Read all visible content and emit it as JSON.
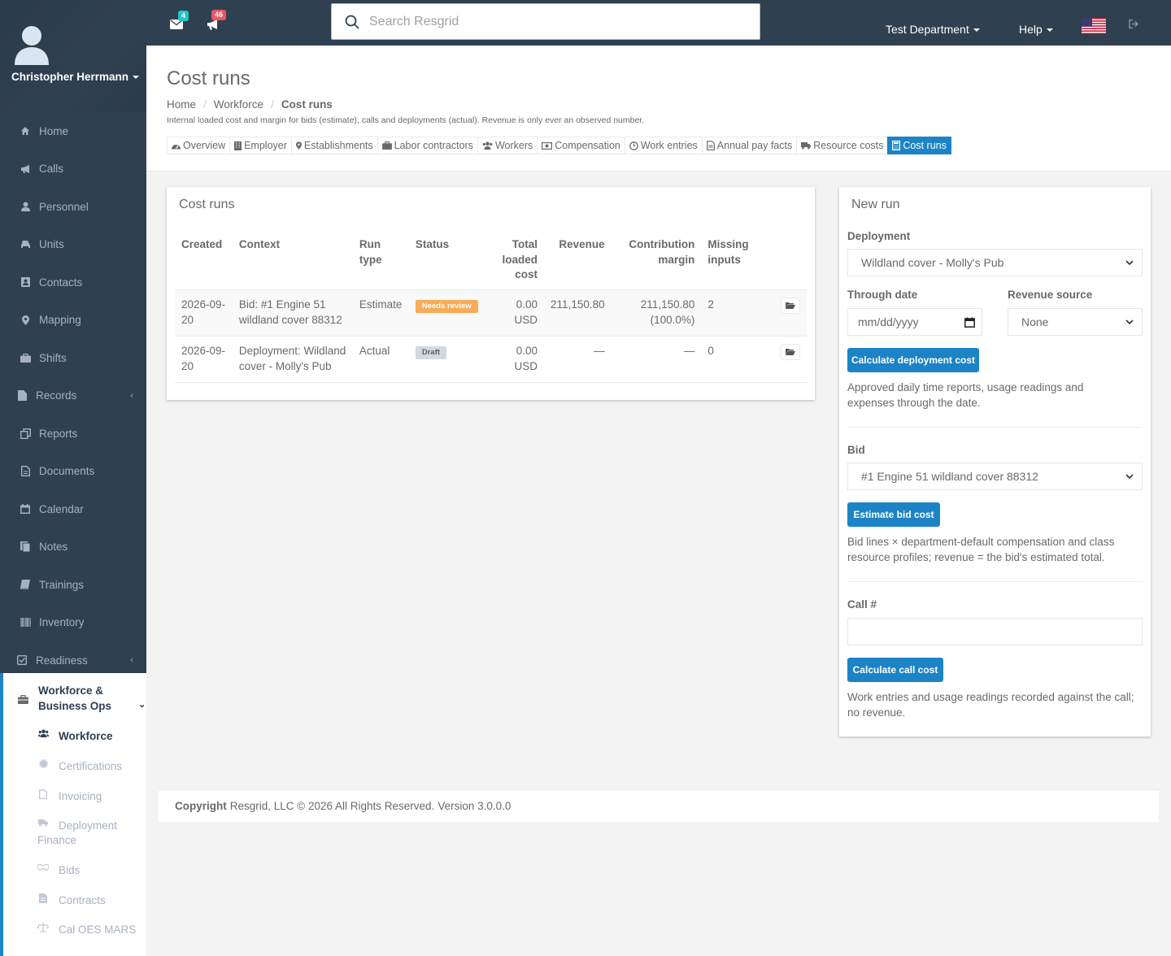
{
  "user": {
    "name": "Christopher Herrmann"
  },
  "topbar": {
    "mail_count": "4",
    "alert_count": "46",
    "search_placeholder": "Search Resgrid",
    "department": "Test Department",
    "help": "Help",
    "colors": {
      "bar": "#2f4050",
      "mail_badge": "#23c6c8",
      "alert_badge": "#ed5565"
    }
  },
  "sidebar": {
    "items": [
      {
        "label": "Home",
        "icon": "home-icon"
      },
      {
        "label": "Calls",
        "icon": "bullhorn-icon"
      },
      {
        "label": "Personnel",
        "icon": "user-icon"
      },
      {
        "label": "Units",
        "icon": "truck-icon"
      },
      {
        "label": "Contacts",
        "icon": "address-book-icon"
      },
      {
        "label": "Mapping",
        "icon": "map-marker-icon"
      },
      {
        "label": "Shifts",
        "icon": "briefcase-icon"
      },
      {
        "label": "Records",
        "icon": "file-icon"
      },
      {
        "label": "Reports",
        "icon": "copy-icon"
      },
      {
        "label": "Documents",
        "icon": "document-icon"
      },
      {
        "label": "Calendar",
        "icon": "calendar-icon"
      },
      {
        "label": "Notes",
        "icon": "notes-icon"
      },
      {
        "label": "Trainings",
        "icon": "book-icon"
      },
      {
        "label": "Inventory",
        "icon": "barcode-icon"
      },
      {
        "label": "Readiness",
        "icon": "check-square-icon"
      }
    ],
    "active_group": {
      "label_line1": "Workforce &",
      "label_line2": "Business Ops",
      "children": [
        {
          "label": "Workforce",
          "icon": "users-icon"
        },
        {
          "label": "Certifications",
          "icon": "certificate-icon"
        },
        {
          "label": "Invoicing",
          "icon": "invoice-icon"
        },
        {
          "label": "Deployment",
          "label2": "Finance",
          "icon": "truck-icon"
        },
        {
          "label": "Bids",
          "icon": "handshake-icon"
        },
        {
          "label": "Contracts",
          "icon": "contract-icon"
        },
        {
          "label": "Cal OES MARS",
          "icon": "balance-scale-icon"
        }
      ]
    }
  },
  "page": {
    "title": "Cost runs",
    "breadcrumb": [
      "Home",
      "Workforce",
      "Cost runs"
    ],
    "subtitle": "Internal loaded cost and margin for bids (estimate), calls and deployments (actual). Revenue is only ever an observed number.",
    "tabs": [
      {
        "label": "Overview",
        "icon": "dashboard-icon"
      },
      {
        "label": "Employer",
        "icon": "building-icon"
      },
      {
        "label": "Establishments",
        "icon": "map-marker-icon"
      },
      {
        "label": "Labor contractors",
        "icon": "briefcase-icon"
      },
      {
        "label": "Workers",
        "icon": "users-icon"
      },
      {
        "label": "Compensation",
        "icon": "money-icon"
      },
      {
        "label": "Work entries",
        "icon": "clock-icon"
      },
      {
        "label": "Annual pay facts",
        "icon": "file-text-icon"
      },
      {
        "label": "Resource costs",
        "icon": "truck-icon"
      },
      {
        "label": "Cost runs",
        "icon": "calculator-icon"
      }
    ]
  },
  "runs": {
    "title": "Cost runs",
    "headers": {
      "created": "Created",
      "context": "Context",
      "run_type_1": "Run",
      "run_type_2": "type",
      "status": "Status",
      "total_1": "Total",
      "total_2": "loaded",
      "total_3": "cost",
      "revenue": "Revenue",
      "margin_1": "Contribution",
      "margin_2": "margin",
      "missing_1": "Missing",
      "missing_2": "inputs"
    },
    "rows": [
      {
        "created_1": "2026-09-",
        "created_2": "20",
        "context_1": "Bid: #1 Engine 51",
        "context_2": "wildland cover 88312",
        "run_type": "Estimate",
        "status": "Needs review",
        "total": "0.00 USD",
        "revenue": "211,150.80",
        "margin_1": "211,150.80",
        "margin_2": "(100.0%)",
        "missing": "2"
      },
      {
        "created_1": "2026-09-",
        "created_2": "20",
        "context_1": "Deployment: Wildland",
        "context_2": "cover - Molly's Pub",
        "run_type": "Actual",
        "status": "Draft",
        "total": "0.00 USD",
        "revenue": "—",
        "margin_1": "—",
        "margin_2": "",
        "missing": "0"
      }
    ]
  },
  "new_run": {
    "title": "New run",
    "deployment_label": "Deployment",
    "deployment_value": "Wildland cover - Molly's Pub",
    "through_date_label": "Through date",
    "through_date_placeholder": "mm/dd/yyyy",
    "revenue_source_label": "Revenue source",
    "revenue_source_value": "None",
    "calc_deployment_button": "Calculate deployment cost",
    "deployment_help": "Approved daily time reports, usage readings and expenses through the date.",
    "bid_label": "Bid",
    "bid_value": "#1 Engine 51 wildland cover 88312",
    "estimate_bid_button": "Estimate bid cost",
    "bid_help": "Bid lines × department-default compensation and class resource profiles; revenue = the bid's estimated total.",
    "call_label": "Call #",
    "call_value": "",
    "calc_call_button": "Calculate call cost",
    "call_help": "Work entries and usage readings recorded against the call; no revenue."
  },
  "footer": {
    "copyright": "Copyright",
    "text": "Resgrid, LLC © 2026 All Rights Reserved.",
    "version": "Version 3.0.0.0"
  }
}
